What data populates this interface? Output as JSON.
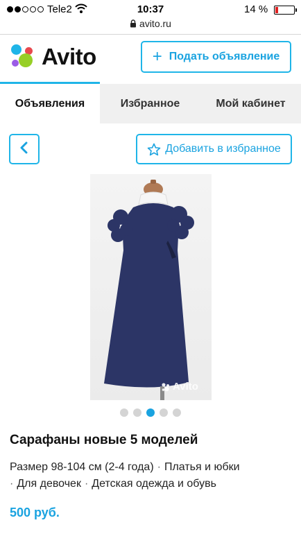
{
  "status_bar": {
    "carrier": "Tele2",
    "time": "10:37",
    "battery_percent": "14 %",
    "battery_level": 0.14,
    "signal_bars_filled": 2,
    "signal_bars_total": 5
  },
  "browser": {
    "url": "avito.ru"
  },
  "header": {
    "logo_text": "Avito",
    "post_ad_label": "Подать объявление",
    "logo_dot_colors": [
      "#1fb5e8",
      "#e8484e",
      "#97cf26",
      "#9b5ce6"
    ]
  },
  "tabs": [
    {
      "label": "Объявления",
      "active": true
    },
    {
      "label": "Избранное",
      "active": false
    },
    {
      "label": "Мой кабинет",
      "active": false
    }
  ],
  "actions": {
    "favorite_label": "Добавить в избранное"
  },
  "photo": {
    "watermark": "Avito",
    "pages_total": 5,
    "current_page": 3
  },
  "listing": {
    "title": "Сарафаны новые 5 моделей",
    "size": "Размер 98-104 см (2-4 года)",
    "categories": [
      "Платья и юбки",
      "Для девочек",
      "Детская одежда и обувь"
    ],
    "price": "500 руб."
  },
  "colors": {
    "accent": "#1fb5e8",
    "dress": "#2c3566"
  }
}
